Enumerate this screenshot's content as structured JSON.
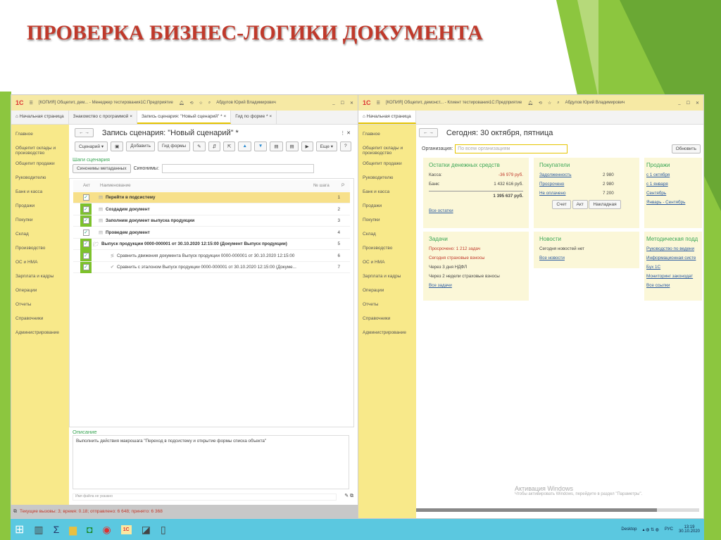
{
  "slide": {
    "title": "ПРОВЕРКА БИЗНЕС-ЛОГИКИ ДОКУМЕНТА"
  },
  "left": {
    "titlebar": "[КОПИЯ] Общепит, дем... - Менеджер тестирования1С:Предприятие",
    "user": "Абдулов Юрий Владимирович",
    "tabs": [
      "Начальная страница",
      "Знакомство с программой",
      "Запись сценария: \"Новый сценарий\" *",
      "Гид по форме *"
    ],
    "sidebar": [
      "Главное",
      "Общепит склады и производство",
      "Общепит продажи",
      "Руководителю",
      "Банк и касса",
      "Продажи",
      "Покупки",
      "Склад",
      "Производство",
      "ОС и НМА",
      "Зарплата и кадры",
      "Операции",
      "Отчеты",
      "Справочники",
      "Администрирование"
    ],
    "form_title": "Запись сценария: \"Новый сценарий\" *",
    "toolbar": {
      "scenario": "Сценарий ▾",
      "add": "Добавить",
      "guide": "Гид формы",
      "more": "Еще ▾",
      "help": "?"
    },
    "steps_label": "Шаги сценария",
    "synonyms_button": "Синонимы метаданных",
    "synonyms_label": "Синонимы:",
    "columns": {
      "active": "Акт",
      "name": "Наименование",
      "step": "№ шага",
      "p": "Р"
    },
    "steps": [
      {
        "name": "Перейти в подсистему",
        "n": "1",
        "bold": true
      },
      {
        "name": "Создадим документ",
        "n": "2",
        "bold": true
      },
      {
        "name": "Заполним документ выпуска продукции",
        "n": "3",
        "bold": true
      },
      {
        "name": "Проведем документ",
        "n": "4",
        "bold": true
      },
      {
        "name": "Выпуск продукции 0000-000001 от 30.10.2020 12:15:00 (Документ Выпуск продукции)",
        "n": "5",
        "bold": true
      },
      {
        "name": "Сравнить движения документа Выпуск продукции 0000-000001 от 30.10.2020 12:15:00",
        "n": "6",
        "bold": false
      },
      {
        "name": "Сравнить с эталоном Выпуск продукции 0000-000001 от 30.10.2020 12:15:00 (Докуме...",
        "n": "7",
        "bold": false
      }
    ],
    "desc_label": "Описание",
    "desc_text": "Выполнить действия макрошага \"Переход в подсистему и открытие формы списка объекта\"",
    "file_placeholder": "Имя файла не указано",
    "status": "Текущие вызовы: 3; время: 0.18; отправлено: 6 648; принято: 6 368"
  },
  "right": {
    "titlebar": "[КОПИЯ] Общепит, демонст... - Клиент тестирования1С:Предприятие",
    "user": "Абдулов Юрий Владимирович",
    "tab": "Начальная страница",
    "sidebar": [
      "Главное",
      "Общепит склады и производство",
      "Общепит продажи",
      "Руководителю",
      "Банк и касса",
      "Продажи",
      "Покупки",
      "Склад",
      "Производство",
      "ОС и НМА",
      "Зарплата и кадры",
      "Операции",
      "Отчеты",
      "Справочники",
      "Администрирование"
    ],
    "form_title": "Сегодня: 30 октября, пятница",
    "org_label": "Организация:",
    "org_placeholder": "По всем организациям",
    "refresh": "Обновить",
    "cash": {
      "title": "Остатки денежных средств",
      "kassa_label": "Касса:",
      "kassa": "-36 979 руб.",
      "bank_label": "Банк:",
      "bank": "1 432 616 руб.",
      "total": "1 395 637 руб.",
      "link": "Все остатки"
    },
    "buyers": {
      "title": "Покупатели",
      "rows": [
        {
          "label": "Задолженность",
          "v": "2 980"
        },
        {
          "label": "Просрочено",
          "v": "2 980"
        },
        {
          "label": "Не оплачено",
          "v": "7 200"
        }
      ],
      "buttons": [
        "Счет",
        "Акт",
        "Накладная"
      ]
    },
    "sales": {
      "title": "Продажи",
      "links": [
        "с 1 октября",
        "с 1 января",
        "Сентябрь",
        "Январь - Сентябрь"
      ]
    },
    "tasks": {
      "title": "Задачи",
      "overdue": "Просрочено: 1 212 задач",
      "today": "Сегодня страховые взносы",
      "l3": "Через 3 дня НДФЛ",
      "l4": "Через 2 недели страховые взносы",
      "link": "Все задачи"
    },
    "news": {
      "title": "Новости",
      "text": "Сегодня новостей нет",
      "link": "Все новости"
    },
    "method": {
      "title": "Методическая подд",
      "links": [
        "Руководство по ведени",
        "Информационная систе",
        "Бух 1С",
        "Мониторинг законодат",
        "Все ссылки"
      ]
    },
    "activation": {
      "title": "Активация Windows",
      "text": "Чтобы активировать Windows, перейдите в раздел \"Параметры\"."
    }
  },
  "taskbar": {
    "desktop": "Desktop",
    "lang": "РУС",
    "time": "13:19",
    "date": "30.10.2020"
  }
}
